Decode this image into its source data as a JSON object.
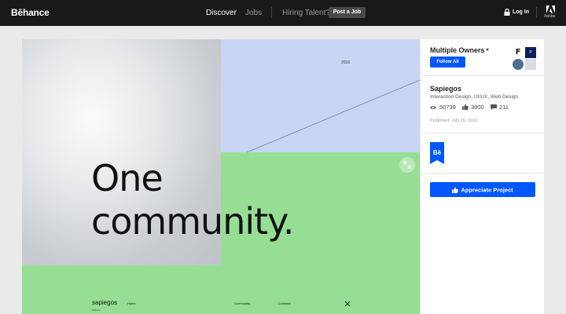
{
  "header": {
    "logo": "Bēhance",
    "nav_discover": "Discover",
    "nav_jobs": "Jobs",
    "nav_hiring": "Hiring Talent?",
    "post_job": "Post a Job",
    "login": "Log In",
    "adobe": "Adobe"
  },
  "project_image": {
    "year": "2016",
    "headline_line1": "One",
    "headline_line2": "community.",
    "site_brand": "sapiegos",
    "site_sub": "Gdańsk",
    "site_nav": [
      "Home",
      "Community",
      "Contacts"
    ]
  },
  "sidebar": {
    "owners_title": "Multiple Owners",
    "follow_all": "Follow All",
    "owner_initial_1": "F",
    "owner_initial_2": "P",
    "project_title": "Sapiegos",
    "project_fields": "Interaction Design, UI/UX, Web Design",
    "views": "50739",
    "appreciations": "3800",
    "comments": "211",
    "published": "Published: July 26, 2016",
    "badge": "Bē",
    "appreciate_button": "Appreciate Project"
  },
  "colors": {
    "topbar": "#191919",
    "brand_blue": "#0057ff",
    "green": "#96de94",
    "sky_blue": "#c8d6f3"
  }
}
